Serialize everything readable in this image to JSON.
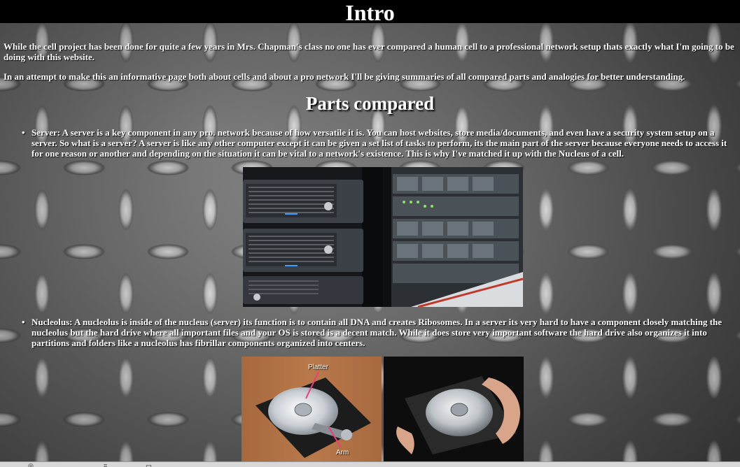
{
  "header": {
    "title": "Intro"
  },
  "intro": {
    "paragraph_1": "While the cell project has been done for quite a few years in Mrs. Chapman's class no one has ever compared a human cell to a professional network setup thats exactly what I'm going to be doing with this website.",
    "paragraph_2": "In an attempt to make this an informative page both about cells and about a pro network I'll be giving summaries of all compared parts and analogies for better understanding."
  },
  "parts": {
    "title": "Parts compared",
    "items": [
      {
        "text": "Server: A server is a key component in any pro. network because of how versatile it is. You can host websites, store media/documents, and even have a security system setup on a server. So what is a server? A server is like any other computer except it can be given a set list of tasks to perform, its the main part of the server because everyone needs to access it for one reason or another and depending on the situation it can be vital to a network's existence. This is why I've matched it up with the Nucleus of a cell."
      },
      {
        "text": "Nucleolus: A nucleolus is inside of the nucleus (server) its function is to contain all DNA and creates Ribosomes. In a server its very hard to have a component closely matching the nucleolus but the hard drive where all important files and your OS is stored is a decent match. While it does store very important software the hard drive also organizes it into partitions and folders like a nucleolus has fibrillar components organized into centers."
      }
    ]
  },
  "drive_labels": {
    "platter": "Platter",
    "arm": "Arm"
  },
  "colors": {
    "accent_pink": "#e8407a",
    "text": "#ffffff",
    "header_bg": "#000000"
  }
}
